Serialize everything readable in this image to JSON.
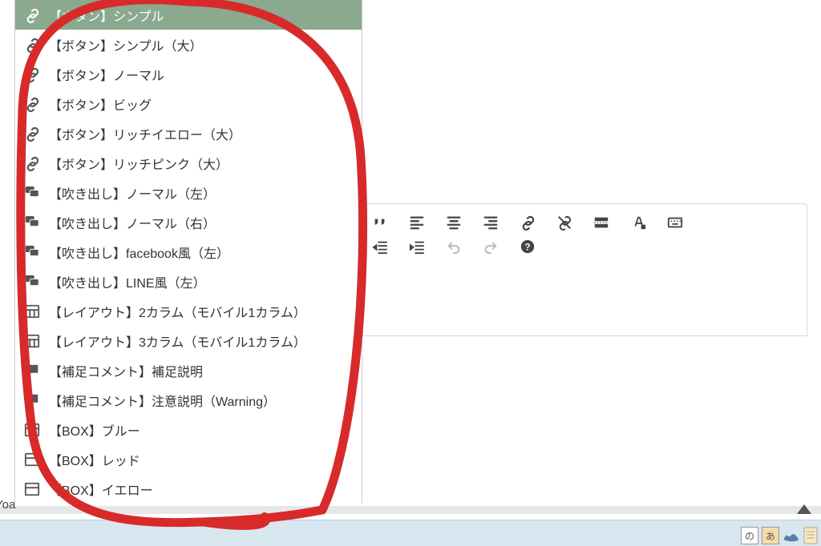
{
  "menu": {
    "items": [
      {
        "icon": "link",
        "label": "【ボタン】シンプル",
        "selected": true
      },
      {
        "icon": "link",
        "label": "【ボタン】シンプル（大）"
      },
      {
        "icon": "link",
        "label": "【ボタン】ノーマル"
      },
      {
        "icon": "link",
        "label": "【ボタン】ビッグ"
      },
      {
        "icon": "link",
        "label": "【ボタン】リッチイエロー（大）"
      },
      {
        "icon": "link",
        "label": "【ボタン】リッチピンク（大）"
      },
      {
        "icon": "chat",
        "label": "【吹き出し】ノーマル（左）"
      },
      {
        "icon": "chat",
        "label": "【吹き出し】ノーマル（右）"
      },
      {
        "icon": "chat",
        "label": "【吹き出し】facebook風（左）"
      },
      {
        "icon": "chat",
        "label": "【吹き出し】LINE風（左）"
      },
      {
        "icon": "grid",
        "label": "【レイアウト】2カラム（モバイル1カラム）"
      },
      {
        "icon": "grid",
        "label": "【レイアウト】3カラム（モバイル1カラム）"
      },
      {
        "icon": "comment",
        "label": "【補足コメント】補足説明"
      },
      {
        "icon": "comment",
        "label": "【補足コメント】注意説明（Warning）"
      },
      {
        "icon": "box",
        "label": "【BOX】ブルー"
      },
      {
        "icon": "box",
        "label": "【BOX】レッド"
      },
      {
        "icon": "box",
        "label": "【BOX】イエロー"
      }
    ]
  },
  "toolbar": {
    "row1": [
      "quote",
      "align-left",
      "align-center",
      "align-right",
      "link",
      "unlink",
      "read-more",
      "text-color",
      "keyboard"
    ],
    "row2": [
      "outdent",
      "indent",
      "undo",
      "redo",
      "help"
    ]
  },
  "footer": {
    "left_text": "Yoa"
  },
  "ime": {
    "badge": "あ"
  },
  "colors": {
    "selected_bg": "#8ba98e",
    "annotation": "#d82a2a",
    "taskbar": "#d8e7ef"
  }
}
